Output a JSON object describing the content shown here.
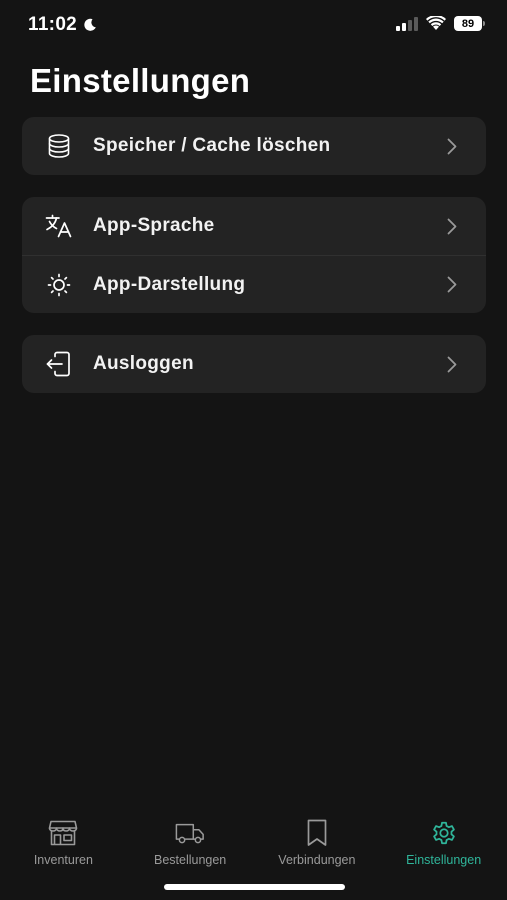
{
  "status_bar": {
    "time": "11:02",
    "battery": "89"
  },
  "page": {
    "title": "Einstellungen"
  },
  "groups": [
    {
      "items": [
        {
          "label": "Speicher / Cache löschen",
          "icon": "database-icon"
        }
      ]
    },
    {
      "items": [
        {
          "label": "App-Sprache",
          "icon": "translate-icon"
        },
        {
          "label": "App-Darstellung",
          "icon": "sun-icon"
        }
      ]
    },
    {
      "items": [
        {
          "label": "Ausloggen",
          "icon": "logout-icon"
        }
      ]
    }
  ],
  "tab_bar": {
    "tabs": [
      {
        "label": "Inventuren",
        "icon": "store-icon"
      },
      {
        "label": "Bestellungen",
        "icon": "truck-icon"
      },
      {
        "label": "Verbindungen",
        "icon": "bookmark-icon"
      },
      {
        "label": "Einstellungen",
        "icon": "gear-icon",
        "active": true
      }
    ]
  },
  "colors": {
    "background": "#141414",
    "card": "#232323",
    "accent": "#2fb59a",
    "inactive_tab": "#9a9a9a"
  }
}
